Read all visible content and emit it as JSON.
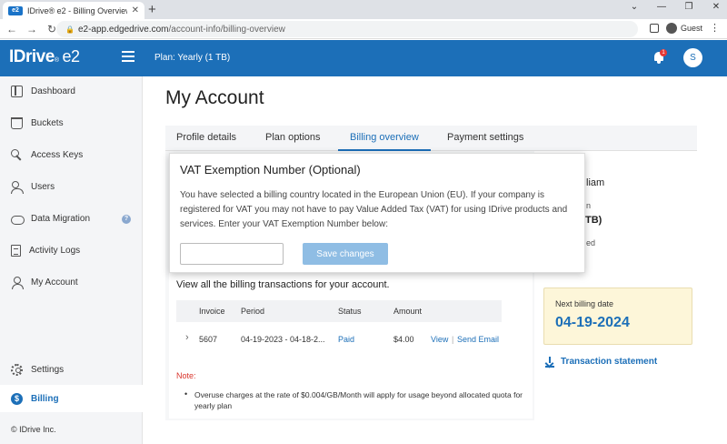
{
  "browser": {
    "tab_title": "IDrive® e2 - Billing Overview",
    "tab_favicon": "e2",
    "url_domain": "e2-app.edgedrive.com",
    "url_path": "/account-info/billing-overview",
    "profile_label": "Guest"
  },
  "header": {
    "logo_text": "IDrive",
    "logo_reg": "®",
    "logo_suffix": "e2",
    "plan_label": "Plan: Yearly (1 TB)",
    "notification_count": "1",
    "user_initial": "S",
    "accent_color": "#1c6fb8"
  },
  "sidebar": {
    "items": [
      {
        "label": "Dashboard",
        "icon": "dashboard-icon"
      },
      {
        "label": "Buckets",
        "icon": "bucket-icon"
      },
      {
        "label": "Access Keys",
        "icon": "key-icon"
      },
      {
        "label": "Users",
        "icon": "users-icon"
      },
      {
        "label": "Data Migration",
        "icon": "cloud-icon"
      },
      {
        "label": "Activity Logs",
        "icon": "document-icon"
      },
      {
        "label": "My Account",
        "icon": "person-icon"
      },
      {
        "label": "Settings",
        "icon": "gear-icon"
      },
      {
        "label": "Billing",
        "icon": "dollar-icon"
      }
    ],
    "help_glyph": "?",
    "copyright": "© IDrive Inc."
  },
  "main": {
    "title": "My Account",
    "tabs": [
      {
        "label": "Profile details"
      },
      {
        "label": "Plan options"
      },
      {
        "label": "Billing overview"
      },
      {
        "label": "Payment settings"
      }
    ],
    "billing_heading": "View all the billing transactions for your account.",
    "table": {
      "headers": [
        "Invoice",
        "Period",
        "Status",
        "Amount"
      ],
      "row": {
        "invoice": "5607",
        "period": "04-19-2023 - 04-18-2...",
        "status": "Paid",
        "amount": "$4.00",
        "view": "View",
        "separator": "|",
        "send_email": "Send Email"
      }
    },
    "note_label": "Note:",
    "note_text": "Overuse charges at the rate of $0.004/GB/Month will apply for usage beyond allocated quota for yearly plan",
    "right_fragments": [
      "liam",
      "n",
      "TB)",
      "ed"
    ],
    "next_billing_label": "Next billing date",
    "next_billing_date": "04-19-2024",
    "transaction_statement": "Transaction statement"
  },
  "vat_popup": {
    "title": "VAT Exemption Number (Optional)",
    "description": "You have selected a billing country located in the European Union (EU). If your company is registered for VAT you may not have to pay Value Added Tax (VAT) for using IDrive products and services. Enter your VAT Exemption Number below:",
    "input_value": "",
    "save_label": "Save changes"
  }
}
